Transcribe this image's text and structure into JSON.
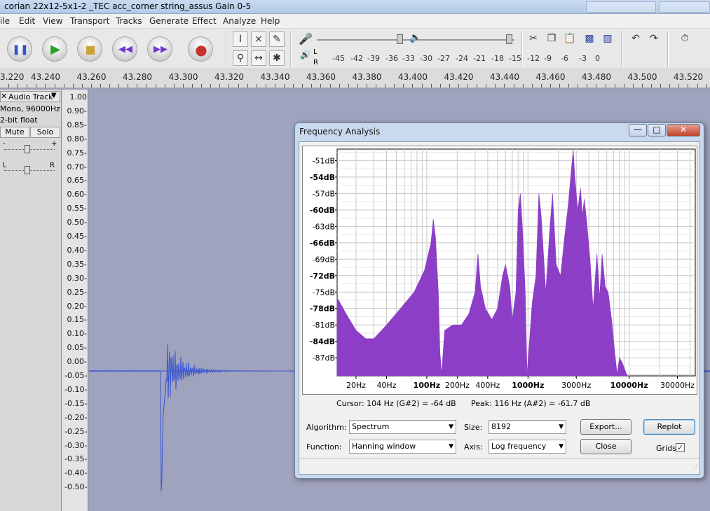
{
  "window": {
    "title": "corian 22x12-5x1-2 _TEC acc_corner string_assus Gain 0-5"
  },
  "menu": [
    "ile",
    "Edit",
    "View",
    "Transport",
    "Tracks",
    "Generate",
    "Effect",
    "Analyze",
    "Help"
  ],
  "meter": {
    "l": "L",
    "r": "R",
    "scale": [
      "-45",
      "-42",
      "-39",
      "-36",
      "-33",
      "-30",
      "-27",
      "-24",
      "-21",
      "-18",
      "-15",
      "-12",
      "-9",
      "-6",
      "-3",
      "0"
    ]
  },
  "ruler": [
    "3.220",
    "43.240",
    "43.260",
    "43.280",
    "43.300",
    "43.320",
    "43.340",
    "43.360",
    "43.380",
    "43.400",
    "43.420",
    "43.440",
    "43.460",
    "43.480",
    "43.500",
    "43.520"
  ],
  "track": {
    "name": "Audio Track",
    "format": "Mono, 96000Hz",
    "bits": "2-bit float",
    "mute": "Mute",
    "solo": "Solo",
    "gain_minus": "-",
    "gain_plus": "+",
    "pan_left": "L",
    "pan_right": "R"
  },
  "yaxis": [
    "1.00",
    "0.90-",
    "0.85-",
    "0.80-",
    "0.75-",
    "0.70-",
    "0.65-",
    "0.60-",
    "0.55-",
    "0.50-",
    "0.45-",
    "0.40-",
    "0.35-",
    "0.30-",
    "0.25-",
    "0.20-",
    "0.15-",
    "0.10-",
    "0.05-",
    "0.00-",
    "-0.05-",
    "-0.10-",
    "-0.15-",
    "-0.20-",
    "-0.25-",
    "-0.30-",
    "-0.35-",
    "-0.40-",
    "-0.50-"
  ],
  "dialog": {
    "title": "Frequency Analysis",
    "cursor_text": "Cursor: 104 Hz (G#2) = -64 dB",
    "peak_text": "Peak: 116 Hz (A#2) = -61.7 dB",
    "algorithm_label": "Algorithm:",
    "algorithm_value": "Spectrum",
    "size_label": "Size:",
    "size_value": "8192",
    "function_label": "Function:",
    "function_value": "Hanning window",
    "axis_label": "Axis:",
    "axis_value": "Log frequency",
    "export_label": "Export...",
    "replot_label": "Replot",
    "close_label": "Close",
    "grids_label": "Grids",
    "grids_checked": true
  },
  "spectrum": {
    "ylabels": [
      "-51dB",
      "-54dB",
      "-57dB",
      "-60dB",
      "-63dB",
      "-66dB",
      "-69dB",
      "-72dB",
      "-75dB",
      "-78dB",
      "-81dB",
      "-84dB",
      "-87dB"
    ],
    "xlabels": [
      "20Hz",
      "40Hz",
      "100Hz",
      "200Hz",
      "400Hz",
      "1000Hz",
      "3000Hz",
      "10000Hz",
      "30000Hz"
    ],
    "fill_color": "#8c3fc6",
    "xlim": [
      13,
      45000
    ],
    "ylim": [
      -90.3,
      -48.9
    ],
    "points": [
      [
        13,
        -76
      ],
      [
        16,
        -79
      ],
      [
        20,
        -82
      ],
      [
        25,
        -83.5
      ],
      [
        30,
        -83.5
      ],
      [
        40,
        -81
      ],
      [
        55,
        -78
      ],
      [
        75,
        -75
      ],
      [
        95,
        -71
      ],
      [
        110,
        -66
      ],
      [
        116,
        -61.7
      ],
      [
        122,
        -65
      ],
      [
        130,
        -75
      ],
      [
        135,
        -86
      ],
      [
        140,
        -90
      ],
      [
        150,
        -82
      ],
      [
        180,
        -81
      ],
      [
        220,
        -81
      ],
      [
        260,
        -79
      ],
      [
        300,
        -75
      ],
      [
        320,
        -68
      ],
      [
        340,
        -74
      ],
      [
        380,
        -78
      ],
      [
        440,
        -80
      ],
      [
        500,
        -78
      ],
      [
        560,
        -72
      ],
      [
        600,
        -70
      ],
      [
        660,
        -74
      ],
      [
        700,
        -80
      ],
      [
        760,
        -75
      ],
      [
        800,
        -60
      ],
      [
        840,
        -57
      ],
      [
        880,
        -63
      ],
      [
        940,
        -75
      ],
      [
        980,
        -90
      ],
      [
        1100,
        -77
      ],
      [
        1200,
        -72
      ],
      [
        1280,
        -57
      ],
      [
        1350,
        -61
      ],
      [
        1500,
        -75
      ],
      [
        1650,
        -63
      ],
      [
        1750,
        -57
      ],
      [
        1900,
        -70
      ],
      [
        2100,
        -72
      ],
      [
        2300,
        -65
      ],
      [
        2500,
        -59
      ],
      [
        2700,
        -52
      ],
      [
        2800,
        -49
      ],
      [
        2900,
        -54
      ],
      [
        3100,
        -60
      ],
      [
        3300,
        -56
      ],
      [
        3450,
        -61
      ],
      [
        3600,
        -58
      ],
      [
        3800,
        -62
      ],
      [
        4100,
        -69
      ],
      [
        4400,
        -78
      ],
      [
        4800,
        -68
      ],
      [
        5100,
        -76
      ],
      [
        5400,
        -68
      ],
      [
        5800,
        -74
      ],
      [
        6200,
        -75
      ],
      [
        6700,
        -80
      ],
      [
        7200,
        -86
      ],
      [
        7600,
        -90
      ],
      [
        8000,
        -87
      ],
      [
        8600,
        -88
      ],
      [
        9200,
        -89.5
      ],
      [
        9600,
        -90.3
      ]
    ]
  }
}
